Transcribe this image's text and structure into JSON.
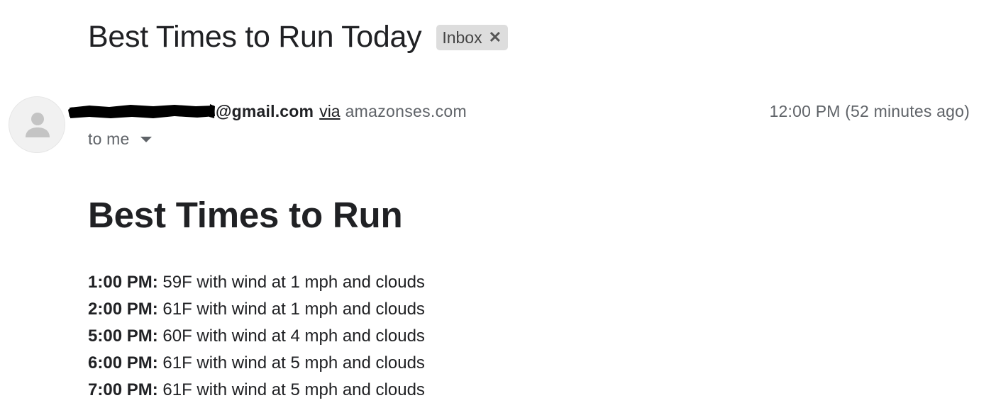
{
  "email": {
    "subject": "Best Times to Run Today",
    "label": "Inbox",
    "label_remove_icon": "close-icon",
    "sender": {
      "avatar_icon": "person-icon",
      "email_visible": "@gmail.com",
      "via_text": "via",
      "via_domain": "amazonses.com"
    },
    "timestamp": "12:00 PM (52 minutes ago)",
    "recipient": "to me",
    "recipient_icon": "caret-down-icon"
  },
  "body": {
    "heading": "Best Times to Run",
    "forecast": [
      {
        "time": "1:00 PM:",
        "details": "59F with wind at 1 mph and clouds"
      },
      {
        "time": "2:00 PM:",
        "details": "61F with wind at 1 mph and clouds"
      },
      {
        "time": "5:00 PM:",
        "details": "60F with wind at 4 mph and clouds"
      },
      {
        "time": "6:00 PM:",
        "details": "61F with wind at 5 mph and clouds"
      },
      {
        "time": "7:00 PM:",
        "details": "61F with wind at 5 mph and clouds"
      }
    ]
  },
  "colors": {
    "text_primary": "#202124",
    "text_secondary": "#5f6368",
    "label_chip_bg": "#dddddd",
    "avatar_bg": "#f1f1f1",
    "avatar_icon": "#c4c4c4",
    "redaction": "#000000"
  }
}
